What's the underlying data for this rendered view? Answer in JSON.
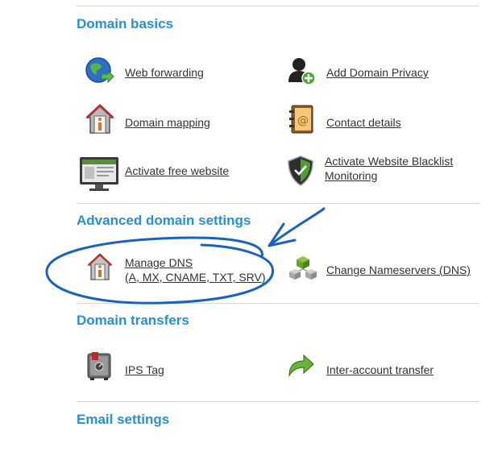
{
  "sections": [
    {
      "title": "Domain basics",
      "items": [
        {
          "label": "Web forwarding",
          "icon": "globe-arrow-icon"
        },
        {
          "label": "Add Domain Privacy",
          "icon": "user-add-icon"
        },
        {
          "label": "Domain mapping",
          "icon": "house-info-icon"
        },
        {
          "label": "Contact details",
          "icon": "address-book-icon"
        },
        {
          "label": "Activate free website",
          "icon": "monitor-website-icon"
        },
        {
          "label_line1": "Activate Website Blacklist",
          "label_line2": "Monitoring",
          "icon": "shield-icon"
        }
      ]
    },
    {
      "title": "Advanced domain settings",
      "items": [
        {
          "label_line1": "Manage DNS",
          "label_line2": "(A, MX, CNAME, TXT, SRV)",
          "icon": "house-dns-icon"
        },
        {
          "label": "Change Nameservers (DNS)",
          "icon": "servers-icon"
        }
      ]
    },
    {
      "title": "Domain transfers",
      "items": [
        {
          "label": "IPS Tag",
          "icon": "safe-icon"
        },
        {
          "label": "Inter-account transfer",
          "icon": "transfer-arrow-icon"
        }
      ]
    },
    {
      "title": "Email settings",
      "items": []
    }
  ],
  "colors": {
    "section_title": "#2a8fd0",
    "annotation": "#1b62b8",
    "divider": "#d6d6d6"
  }
}
